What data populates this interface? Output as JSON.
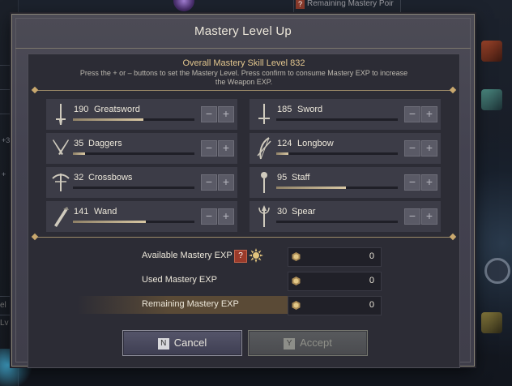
{
  "background": {
    "top_tip": {
      "help_glyph": "?",
      "text": "Remaining Mastery Poir"
    },
    "left_numbers": [
      "+3",
      "+"
    ],
    "left_box_text": "el Lv",
    "icons": [
      "crystal-orb-icon",
      "skill-icon-fire",
      "skill-icon-slash",
      "skill-icon-rune",
      "gear-orb-icon"
    ]
  },
  "dialog": {
    "title": "Mastery Level Up",
    "overall": {
      "title": "Overall Mastery Skill Level 832",
      "description": "Press the + or – buttons to set the Mastery Level. Press confirm to consume Mastery EXP to increase the Weapon EXP."
    },
    "weapons": [
      {
        "level": "190",
        "name": "Greatsword",
        "progress": 0.58,
        "icon": "greatsword-icon",
        "minus": "−",
        "plus": "+"
      },
      {
        "level": "185",
        "name": "Sword",
        "progress": 0.0,
        "icon": "sword-icon",
        "minus": "−",
        "plus": "+"
      },
      {
        "level": "35",
        "name": "Daggers",
        "progress": 0.1,
        "icon": "daggers-icon",
        "minus": "−",
        "plus": "+"
      },
      {
        "level": "124",
        "name": "Longbow",
        "progress": 0.1,
        "icon": "longbow-icon",
        "minus": "−",
        "plus": "+"
      },
      {
        "level": "32",
        "name": "Crossbows",
        "progress": 0.0,
        "icon": "crossbow-icon",
        "minus": "−",
        "plus": "+"
      },
      {
        "level": "95",
        "name": "Staff",
        "progress": 0.57,
        "icon": "staff-icon",
        "minus": "−",
        "plus": "+"
      },
      {
        "level": "141",
        "name": "Wand",
        "progress": 0.6,
        "icon": "wand-icon",
        "minus": "−",
        "plus": "+"
      },
      {
        "level": "30",
        "name": "Spear",
        "progress": 0.0,
        "icon": "spear-icon",
        "minus": "−",
        "plus": "+"
      }
    ],
    "exp": {
      "available": {
        "label": "Available Mastery EXP",
        "value": "0",
        "help": "?"
      },
      "used": {
        "label": "Used Mastery EXP",
        "value": "0"
      },
      "remaining": {
        "label": "Remaining Mastery EXP",
        "value": "0"
      }
    },
    "buttons": {
      "cancel": {
        "key": "N",
        "label": "Cancel"
      },
      "accept": {
        "key": "Y",
        "label": "Accept"
      }
    }
  }
}
